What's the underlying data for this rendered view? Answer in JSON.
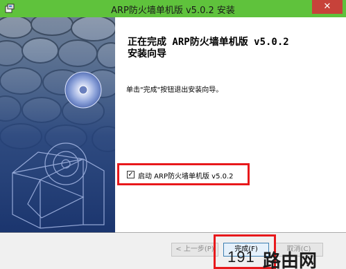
{
  "window": {
    "title": "ARP防火墙单机版 v5.0.2 安装",
    "close_symbol": "✕"
  },
  "wizard": {
    "heading": "正在完成 ARP防火墙单机版 v5.0.2\n安装向导",
    "description": "单击\"完成\"按钮退出安装向导。",
    "launch_checkbox_checked": true,
    "launch_checkbox_mark": "✓",
    "launch_label": "启动 ARP防火墙单机版 v5.0.2"
  },
  "buttons": {
    "back": "< 上一步(P)",
    "finish": "完成(F)",
    "cancel": "取消(C)"
  },
  "watermark": {
    "number": "191",
    "text": "路由网"
  },
  "colors": {
    "titlebar": "#5fc23c",
    "highlight": "#e8181b",
    "side_panel": "#2b4f8c"
  }
}
